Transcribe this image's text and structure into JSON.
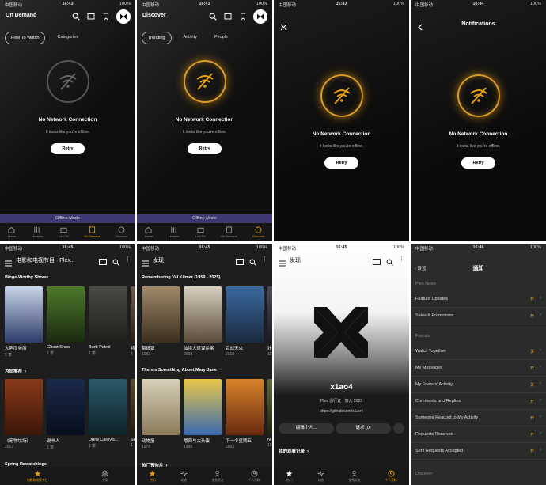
{
  "status": {
    "carrier": "中国移动",
    "battery": "100%",
    "times": [
      "16:43",
      "16:43",
      "16:43",
      "16:44",
      "16:45",
      "16:45",
      "16:45",
      "16:46"
    ]
  },
  "panel1": {
    "title": "On Demand",
    "tabs": [
      "Free To Watch",
      "Categories"
    ],
    "offline": {
      "title": "No Network Connection",
      "sub": "It looks like you're offline.",
      "retry": "Retry"
    },
    "offline_bar": "Offline Mode",
    "nav": [
      "Home",
      "Libraries",
      "Live TV",
      "On Demand",
      "Discover"
    ]
  },
  "panel2": {
    "title": "Discover",
    "tabs": [
      "Trending",
      "Activity",
      "People"
    ],
    "offline": {
      "title": "No Network Connection",
      "sub": "It looks like you're offline.",
      "retry": "Retry"
    },
    "offline_bar": "Offline Mode",
    "nav": [
      "Home",
      "Libraries",
      "Live TV",
      "On Demand",
      "Discover"
    ]
  },
  "panel3": {
    "offline": {
      "title": "No Network Connection",
      "sub": "It looks like you're offline.",
      "retry": "Retry"
    }
  },
  "panel4": {
    "title": "Notifications",
    "offline": {
      "title": "No Network Connection",
      "sub": "It looks like you're offline.",
      "retry": "Retry"
    }
  },
  "panel5": {
    "title": "电影和电视节目 · Plex...",
    "sec1": "Binge-Worthy Shows",
    "posters1": [
      {
        "t": "大胆而美丽",
        "s": "2 季",
        "c1": "#c9d6e8",
        "c2": "#2e3b6a"
      },
      {
        "t": "Ghost Show",
        "s": "1 季",
        "c1": "#4e7a2a",
        "c2": "#1a2a10"
      },
      {
        "t": "Burb Patrol",
        "s": "1 季",
        "c1": "#4a4a44",
        "c2": "#1e1e1a"
      },
      {
        "t": "特",
        "s": "4",
        "c1": "#6a5a4a",
        "c2": "#2a2018"
      }
    ],
    "sec2": "为您推荐",
    "posters2": [
      {
        "t": "《宠物坟场》",
        "s": "2017",
        "c1": "#8a3a1a",
        "c2": "#3a1608"
      },
      {
        "t": "说书人",
        "s": "1 季",
        "c1": "#1a2a4a",
        "c2": "#080e1e"
      },
      {
        "t": "Drew Carey's...",
        "s": "1 季",
        "c1": "#2a5a6a",
        "c2": "#0e2228"
      },
      {
        "t": "Se",
        "s": "1",
        "c1": "#5a4a2a",
        "c2": "#201a0e"
      }
    ],
    "sec3": "Spring Rewatchings",
    "nav": [
      "电影和电视节目",
      "分类"
    ]
  },
  "panel6": {
    "title": "发现",
    "sec1": "Remembering Val Kilmer (1959 - 2025)",
    "posters1": [
      {
        "t": "墓碑镇",
        "s": "1993",
        "c1": "#a08a6a",
        "c2": "#3a2e1e"
      },
      {
        "t": "仙境大道谋杀案",
        "s": "2003",
        "c1": "#d8d0c0",
        "c2": "#5a4a3a"
      },
      {
        "t": "百战天虫",
        "s": "2010",
        "c1": "#3a6aa0",
        "c2": "#1a2a40"
      },
      {
        "t": "壮",
        "s": "19",
        "c1": "#4a4a5a",
        "c2": "#1a1a22"
      }
    ],
    "sec2": "There's Something About Mary Jane",
    "posters2": [
      {
        "t": "动物屋",
        "s": "1978",
        "c1": "#d8d0b8",
        "c2": "#8a7a5a"
      },
      {
        "t": "瘪四与大头蛋",
        "s": "1996",
        "c1": "#e8c84a",
        "c2": "#3a6ab0"
      },
      {
        "t": "下一个星期五",
        "s": "2002",
        "c1": "#d8842a",
        "c2": "#6a2a10"
      },
      {
        "t": "N",
        "s": "19",
        "c1": "#5a6a3a",
        "c2": "#1e2410"
      }
    ],
    "sec3": "热门预告片",
    "nav": [
      "热门",
      "动态",
      "查找好友",
      "个人资料"
    ]
  },
  "panel7": {
    "title": "发现",
    "username": "x1ao4",
    "pass": "Plex 通行证",
    "joined": "加入 2023",
    "link": "https://github.com/x1ao4",
    "edit": "编辑个人...",
    "requests": "请求 (0)",
    "history": "我的观看记录",
    "nav": [
      "热门",
      "动态",
      "查找好友",
      "个人资料"
    ]
  },
  "panel8": {
    "back": "设置",
    "title": "通知",
    "group1": "Plex News",
    "rows1": [
      {
        "l": "Feature Updates",
        "v": "开"
      },
      {
        "l": "Sales & Promotions",
        "v": "开"
      }
    ],
    "group2": "Friends",
    "rows2": [
      {
        "l": "Watch Together",
        "v": "关"
      },
      {
        "l": "My Messages",
        "v": "开"
      },
      {
        "l": "My Friends' Activity",
        "v": "关"
      },
      {
        "l": "Comments and Replies",
        "v": "开"
      },
      {
        "l": "Someone Reacted to My Activity",
        "v": "开"
      },
      {
        "l": "Requests Received",
        "v": "开"
      },
      {
        "l": "Sent Requests Accepted",
        "v": "开"
      }
    ],
    "group3": "Discover"
  },
  "colors": {
    "accent": "#e5a00d",
    "offline_bar": "#3d3772",
    "bg": "#0e0e0e"
  }
}
